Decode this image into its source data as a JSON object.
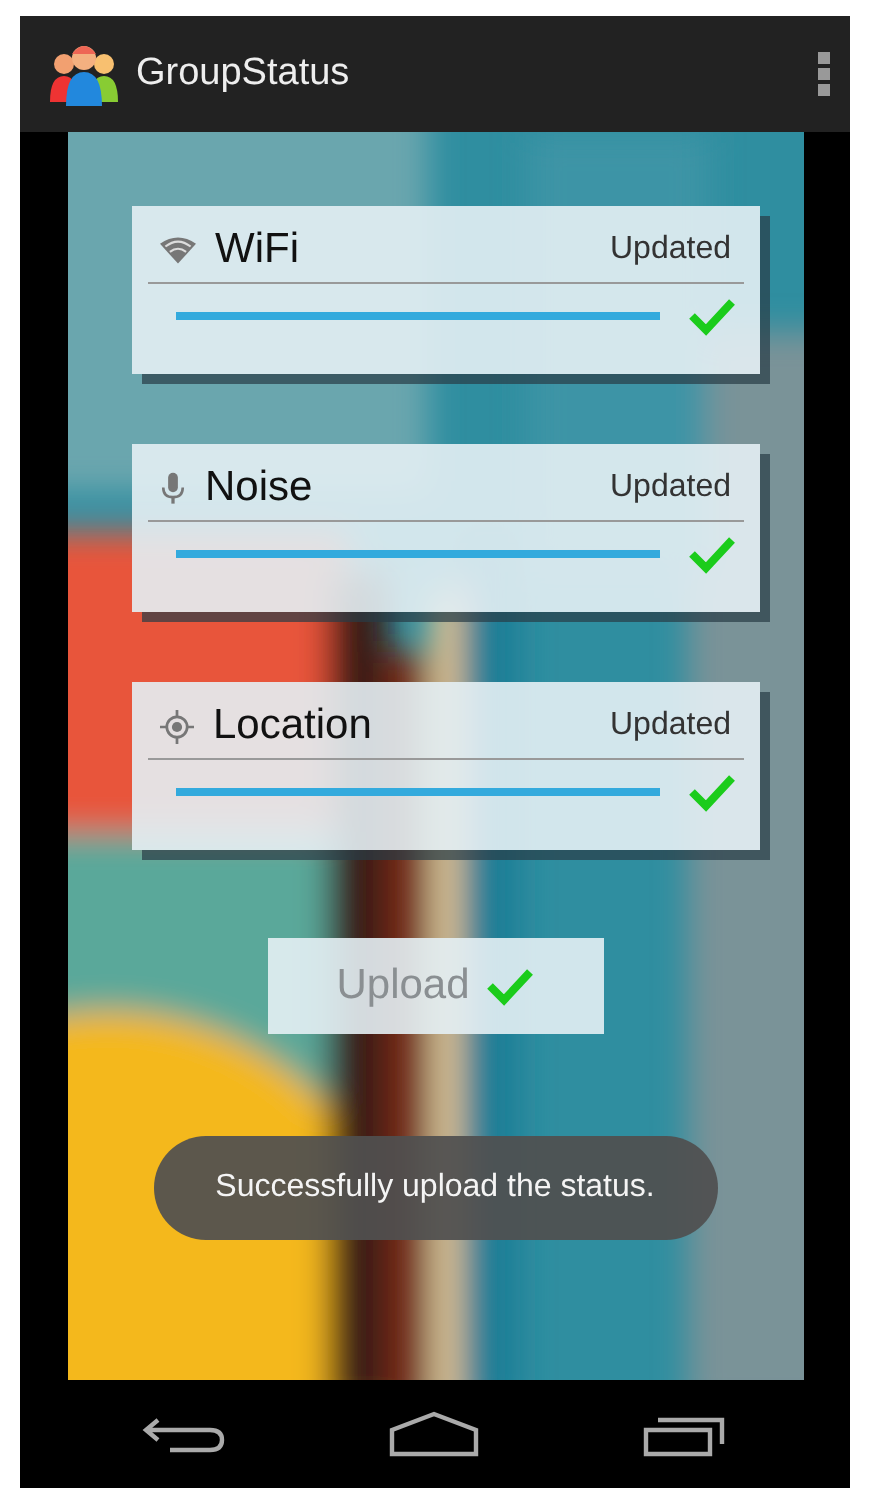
{
  "action_bar": {
    "title": "GroupStatus"
  },
  "sensors": [
    {
      "kind": "wifi",
      "name": "WiFi",
      "status": "Updated",
      "level": 1,
      "checked": true
    },
    {
      "kind": "noise",
      "name": "Noise",
      "status": "Updated",
      "level": 1,
      "checked": true
    },
    {
      "kind": "location",
      "name": "Location",
      "status": "Updated",
      "level": 1,
      "checked": true
    }
  ],
  "upload_button": {
    "label": "Upload",
    "disabled": true,
    "checked": true
  },
  "toast": "Successfully upload the status."
}
